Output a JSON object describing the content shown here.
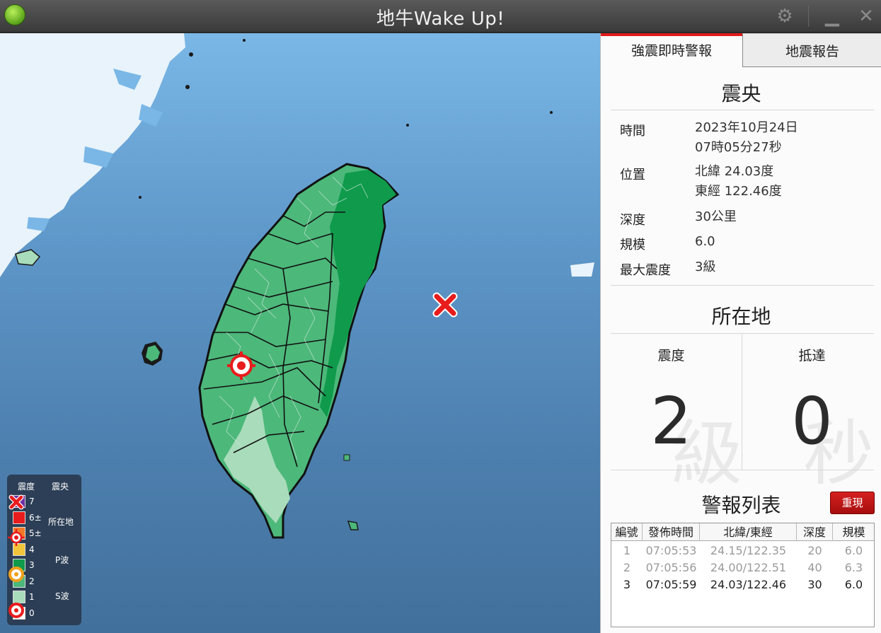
{
  "window": {
    "title": "地牛Wake Up!"
  },
  "tabs": [
    {
      "label": "強震即時警報",
      "active": true
    },
    {
      "label": "地震報告",
      "active": false
    }
  ],
  "epicenter": {
    "heading": "震央",
    "time_label": "時間",
    "time_line1": "2023年10月24日",
    "time_line2": "07時05分27秒",
    "location_label": "位置",
    "lat": "北緯 24.03度",
    "lon": "東經 122.46度",
    "depth_label": "深度",
    "depth": "30公里",
    "magnitude_label": "規模",
    "magnitude": "6.0",
    "max_intensity_label": "最大震度",
    "max_intensity": "3級"
  },
  "location": {
    "heading": "所在地",
    "intensity_label": "震度",
    "intensity_value": "2",
    "intensity_watermark": "級",
    "arrival_label": "抵達",
    "arrival_value": "0",
    "arrival_watermark": "秒"
  },
  "alert_list": {
    "heading": "警報列表",
    "replay_label": "重現",
    "columns": [
      "編號",
      "發佈時間",
      "北緯/東經",
      "深度",
      "規模"
    ],
    "rows": [
      {
        "no": "1",
        "time": "07:05:53",
        "coord": "24.15/122.35",
        "depth": "20",
        "mag": "6.0"
      },
      {
        "no": "2",
        "time": "07:05:56",
        "coord": "24.00/122.51",
        "depth": "40",
        "mag": "6.3"
      },
      {
        "no": "3",
        "time": "07:05:59",
        "coord": "24.03/122.46",
        "depth": "30",
        "mag": "6.0"
      }
    ]
  },
  "legend": {
    "intensity_heading": "震度",
    "epicenter_heading": "震央",
    "location_label": "所在地",
    "pwave_label": "P波",
    "swave_label": "S波",
    "levels": [
      {
        "label": "7",
        "color": "#6e2fa3"
      },
      {
        "label": "6±",
        "color": "#e81c1c"
      },
      {
        "label": "5±",
        "color": "#f07a2c"
      },
      {
        "label": "4",
        "color": "#f2c43a"
      },
      {
        "label": "3",
        "color": "#0f9a4c"
      },
      {
        "label": "2",
        "color": "#4cb87a"
      },
      {
        "label": "1",
        "color": "#a9dcbb"
      },
      {
        "label": "0",
        "color": "#ffffff"
      }
    ]
  },
  "colors": {
    "accent": "#e01a1a",
    "intensity3": "#0f9a4c",
    "intensity2": "#4cb87a",
    "intensity1": "#a9dcbb"
  }
}
